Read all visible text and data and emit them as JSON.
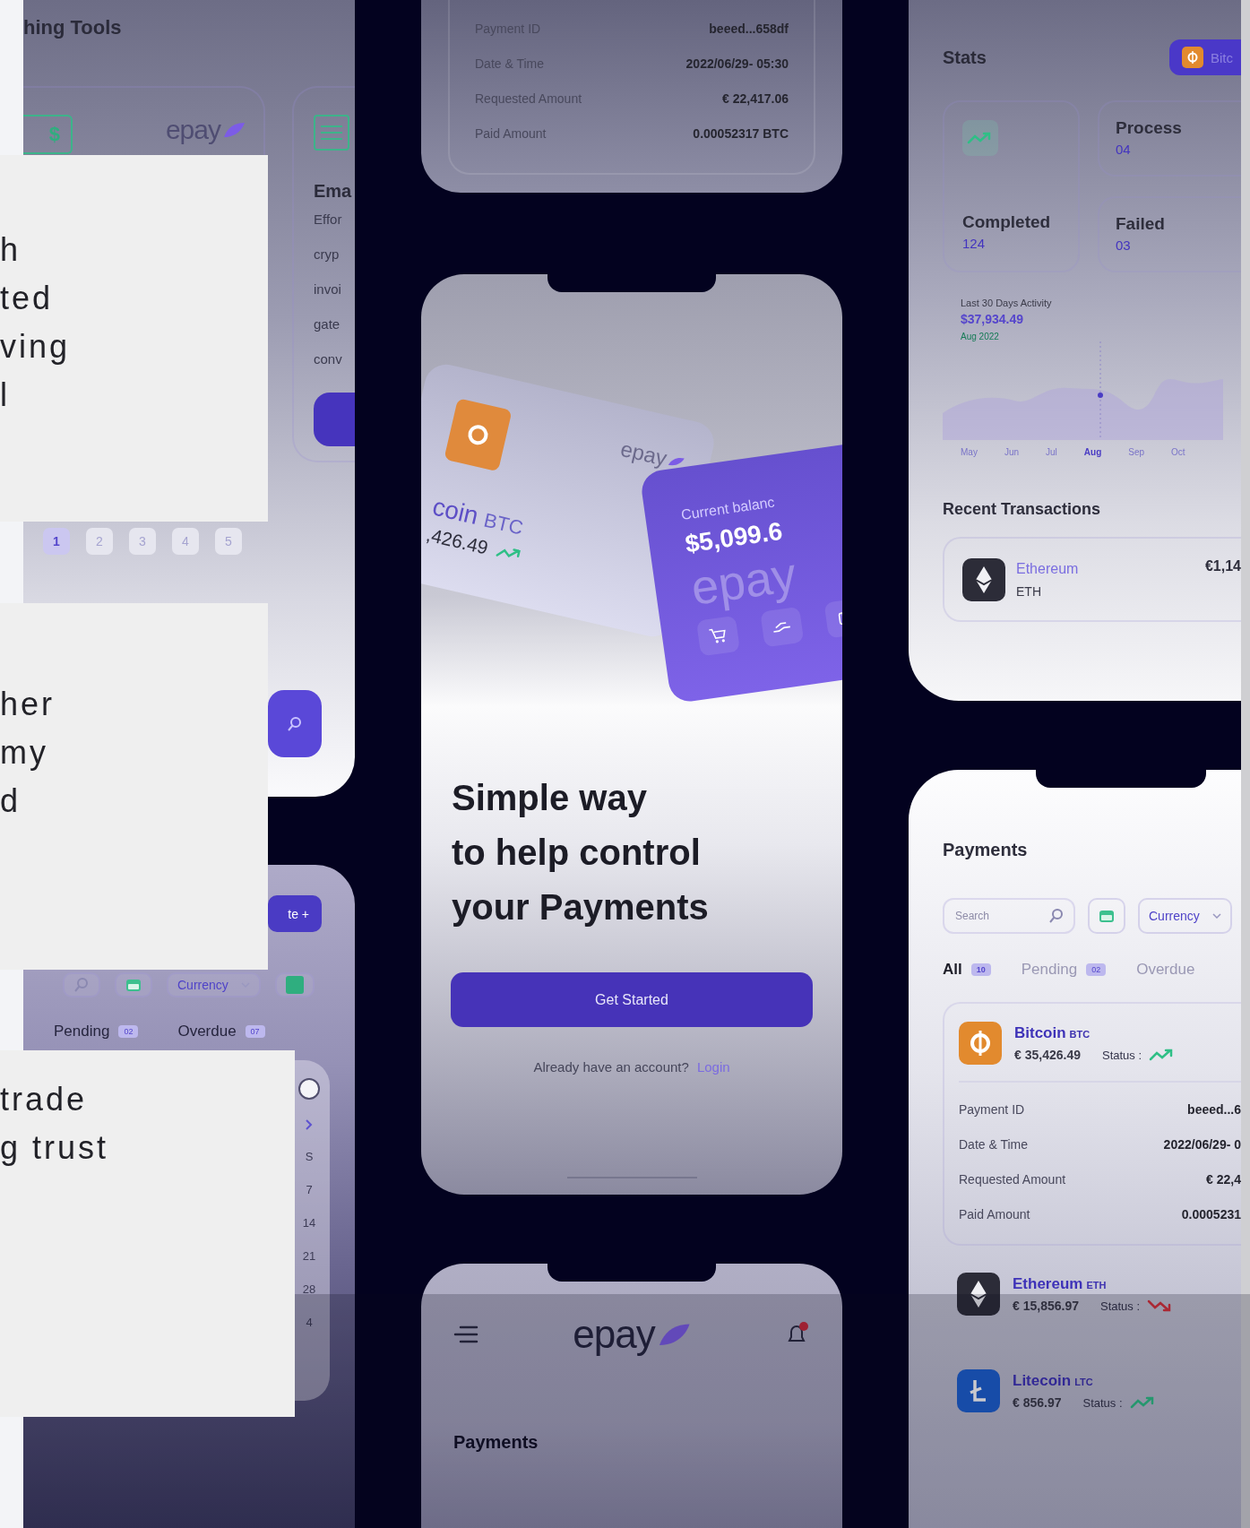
{
  "testimonials": [
    {
      "lines": [
        "h",
        "ted",
        "ving",
        "l"
      ]
    },
    {
      "lines": [
        "her",
        "my",
        "d"
      ]
    },
    {
      "lines": [
        "trade",
        "g trust"
      ]
    }
  ],
  "left_top_screen": {
    "title": "hing Tools",
    "currency_symbol": "$",
    "logo": "epay",
    "email_card": {
      "title": "Ema",
      "lines": [
        "Effor",
        "cryp",
        "invoi",
        "gate",
        "conv"
      ]
    },
    "pages": [
      {
        "label": "1",
        "selected": true
      },
      {
        "label": "2",
        "selected": false
      },
      {
        "label": "3",
        "selected": false
      },
      {
        "label": "4",
        "selected": false
      },
      {
        "label": "5",
        "selected": false
      }
    ]
  },
  "left_bottom_screen": {
    "create_button": "te +",
    "currency_dropdown": "Currency",
    "tabs": [
      {
        "label": "Pending",
        "count": "02",
        "selected": false
      },
      {
        "label": "Overdue",
        "count": "07",
        "selected": false
      }
    ],
    "calendar_column": [
      "S",
      "7",
      "14",
      "21",
      "28",
      "4"
    ]
  },
  "middle_top_screen": {
    "details": [
      {
        "label": "Payment ID",
        "value": "beeed...658df"
      },
      {
        "label": "Date & Time",
        "value": "2022/06/29- 05:30"
      },
      {
        "label": "Requested Amount",
        "value": "€ 22,417.06"
      },
      {
        "label": "Paid Amount",
        "value": "0.00052317 BTC"
      }
    ]
  },
  "onboarding_screen": {
    "coin_card": {
      "logo": "epay",
      "name": "coin",
      "symbol": "BTC",
      "amount": ",426.49"
    },
    "balance_card": {
      "label": "Current balanc",
      "amount": "$5,099.6",
      "watermark": "epay"
    },
    "headline": [
      "Simple way",
      "to help control",
      "your Payments"
    ],
    "button": "Get Started",
    "prompt": "Already have an account?",
    "link": "Login"
  },
  "middle_bottom_screen": {
    "logo": "epay",
    "title": "Payments"
  },
  "stats_screen": {
    "title": "Stats",
    "coin_button": "Bitc",
    "cards": [
      {
        "label": "Completed",
        "value": "124"
      },
      {
        "label": "Process",
        "value": "04"
      },
      {
        "label": "Failed",
        "value": "03"
      }
    ],
    "activity": {
      "label": "Last 30 Days Activity",
      "amount": "$37,934.49",
      "period": "Aug 2022",
      "months": [
        {
          "label": "May",
          "selected": false
        },
        {
          "label": "Jun",
          "selected": false
        },
        {
          "label": "Jul",
          "selected": false
        },
        {
          "label": "Aug",
          "selected": true
        },
        {
          "label": "Sep",
          "selected": false
        },
        {
          "label": "Oct",
          "selected": false
        }
      ]
    },
    "recent_title": "Recent Transactions",
    "transaction": {
      "name": "Ethereum",
      "symbol": "ETH",
      "amount": "€1,14"
    }
  },
  "payments_screen": {
    "title": "Payments",
    "search": {
      "placeholder": "Search"
    },
    "currency_dropdown": "Currency",
    "tabs": [
      {
        "label": "All",
        "count": "10",
        "selected": true
      },
      {
        "label": "Pending",
        "count": "02",
        "selected": false
      },
      {
        "label": "Overdue",
        "selected": false
      }
    ],
    "payments": [
      {
        "kind": "btc",
        "name": "Bitcoin",
        "symbol": "BTC",
        "amount": "€ 35,426.49",
        "status_label": "Status :",
        "rising": true,
        "details": [
          {
            "label": "Payment ID",
            "value": "beeed...6"
          },
          {
            "label": "Date & Time",
            "value": "2022/06/29- 0"
          },
          {
            "label": "Requested Amount",
            "value": "€ 22,4"
          },
          {
            "label": "Paid Amount",
            "value": "0.0005231"
          }
        ]
      },
      {
        "kind": "eth",
        "name": "Ethereum",
        "symbol": "ETH",
        "amount": "€ 15,856.97",
        "status_label": "Status :",
        "rising": false
      },
      {
        "kind": "ltc",
        "name": "Litecoin",
        "symbol": "LTC",
        "amount": "€ 856.97",
        "status_label": "Status :",
        "rising": true
      }
    ]
  }
}
